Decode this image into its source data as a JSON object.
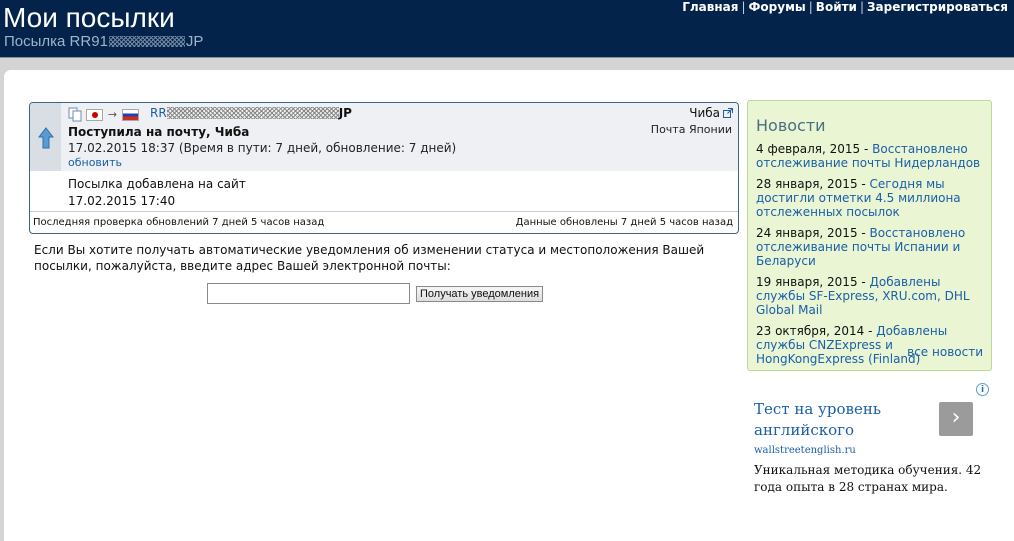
{
  "header": {
    "title": "Мои посылки",
    "subtitle_prefix": "Посылка RR91",
    "subtitle_suffix": "JP",
    "nav": [
      "Главная",
      "Форумы",
      "Войти",
      "Зарегистрироваться"
    ]
  },
  "parcel": {
    "tracking_prefix": "RR",
    "tracking_suffix": "JP",
    "destination": "Чиба",
    "carrier": "Почта Японии",
    "status_title": "Поступила на почту, Чиба",
    "status_date": "17.02.2015 18:37 (Время в пути: 7 дней, обновление: 7 дней)",
    "refresh_label": "обновить",
    "added_label": "Посылка добавлена на сайт",
    "added_date": "17.02.2015 17:40",
    "last_check": "Последняя проверка обновлений 7 дней 5 часов назад",
    "data_updated": "Данные обновлены 7 дней 5 часов назад"
  },
  "notify": {
    "text": "Если Вы хотите получать автоматические уведомления об изменении статуса и местоположения Вашей посылки, пожалуйста, введите адрес Вашей электронной почты:",
    "email_value": "",
    "button_label": "Получать уведомления"
  },
  "news": {
    "title": "Новости",
    "items": [
      {
        "date": "4 февраля, 2015 - ",
        "text": "Восстановлено отслеживание почты Нидерландов"
      },
      {
        "date": "28 января, 2015 - ",
        "text": "Сегодня мы достигли отметки 4.5 миллиона отслеженных посылок"
      },
      {
        "date": "24 января, 2015 - ",
        "text": "Восстановлено отслеживание почты Испании и Беларуси"
      },
      {
        "date": "19 января, 2015 - ",
        "text": "Добавлены службы SF-Express, XRU.com, DHL Global Mail"
      },
      {
        "date": "23 октября, 2014 - ",
        "text": "Добавлены службы CNZExpress и HongKongExpress (Finland)"
      }
    ],
    "all_news": "все новости"
  },
  "ad": {
    "title": "Тест на уровень английского",
    "url": "wallstreetenglish.ru",
    "description": "Уникальная методика обучения. 42 года опыта в 28 странах мира.",
    "next_glyph": "›",
    "info_glyph": "i"
  },
  "colors": {
    "header_bg": "#03234b",
    "link": "#1a5fa8",
    "news_bg": "#e9f5d3",
    "card_border": "#3e6687"
  },
  "icons": [
    "arrow-up-icon",
    "copy-icon",
    "flag-japan-icon",
    "arrow-right-icon",
    "flag-russia-icon",
    "external-link-icon",
    "info-icon",
    "chevron-right-icon"
  ]
}
